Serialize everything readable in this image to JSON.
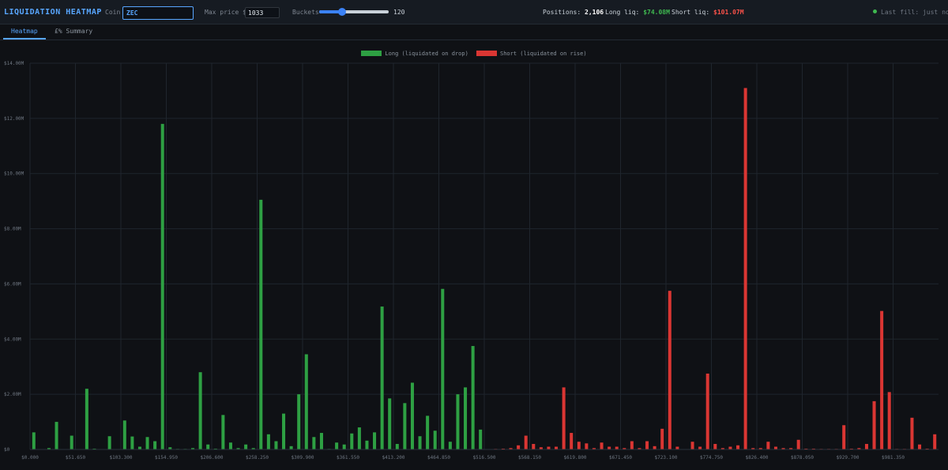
{
  "header": {
    "title": "LIQUIDATION HEATMAP",
    "coin_label": "Coin",
    "coin_value": "ZEC",
    "max_price_label": "Max price $",
    "max_price_value": "1033",
    "buckets_label": "Buckets",
    "buckets_value": "120",
    "buckets_fraction": 0.33,
    "positions_label": "Positions:",
    "positions_value": "2,106",
    "long_liq_label": "Long liq:",
    "long_liq_value": "$74.08M",
    "short_liq_label": "Short liq:",
    "short_liq_value": "$101.07M",
    "status_text": "Last fill: just now",
    "colors": {
      "accent": "#58a6ff",
      "long": "#2ea043",
      "short": "#da3633",
      "status_dot": "#3fb950"
    }
  },
  "tabs": [
    {
      "label": "Heatmap",
      "active": true
    },
    {
      "label": "£% Summary",
      "active": false
    }
  ],
  "chart_data": {
    "type": "bar",
    "legend": [
      {
        "label": "Long (liquidated on drop)",
        "color": "#2ea043"
      },
      {
        "label": "Short (liquidated on rise)",
        "color": "#da3633"
      }
    ],
    "legend_position": "top-center",
    "grid": true,
    "bucket_size": 8.6083,
    "xlim": [
      0,
      1033
    ],
    "ylim": [
      0,
      14000000
    ],
    "y_ticks": [
      0,
      2000000,
      4000000,
      6000000,
      8000000,
      10000000,
      12000000,
      14000000
    ],
    "y_tick_labels": [
      "$0",
      "$2.00M",
      "$4.00M",
      "$6.00M",
      "$8.00M",
      "$10.00M",
      "$12.00M",
      "$14.00M"
    ],
    "x_ticks": [
      0,
      51.65,
      103.3,
      154.95,
      206.6,
      258.25,
      309.9,
      361.55,
      413.2,
      464.85,
      516.5,
      568.15,
      619.8,
      671.45,
      723.1,
      774.75,
      826.4,
      878.05,
      929.7,
      981.35
    ],
    "x_tick_labels": [
      "$0.000",
      "$51.650",
      "$103.300",
      "$154.950",
      "$206.600",
      "$258.250",
      "$309.900",
      "$361.550",
      "$413.200",
      "$464.850",
      "$516.500",
      "$568.150",
      "$619.800",
      "$671.450",
      "$723.100",
      "$774.750",
      "$826.400",
      "$878.050",
      "$929.700",
      "$981.350"
    ],
    "series": [
      {
        "name": "Long (liquidated on drop)",
        "values": [
          0.62,
          0,
          0.05,
          1.0,
          0.01,
          0.5,
          0,
          2.2,
          0.03,
          0,
          0.48,
          0,
          1.05,
          0.47,
          0.1,
          0.45,
          0.3,
          11.8,
          0.08,
          0.02,
          0.02,
          0.05,
          2.8,
          0.18,
          0.03,
          1.25,
          0.25,
          0.05,
          0.18,
          0.05,
          9.05,
          0.55,
          0.3,
          1.3,
          0.12,
          2.0,
          3.45,
          0.45,
          0.6,
          0.02,
          0.25,
          0.18,
          0.58,
          0.8,
          0.32,
          0.62,
          5.18,
          1.85,
          0.2,
          1.68,
          2.42,
          0.48,
          1.22,
          0.68,
          5.82,
          0.28,
          2.0,
          2.25,
          3.75,
          0.72,
          0,
          0,
          0,
          0,
          0,
          0,
          0,
          0,
          0,
          0,
          0,
          0,
          0,
          0,
          0,
          0,
          0,
          0,
          0,
          0,
          0,
          0,
          0,
          0,
          0,
          0,
          0,
          0,
          0,
          0,
          0,
          0,
          0,
          0,
          0,
          0,
          0,
          0,
          0,
          0,
          0,
          0,
          0,
          0,
          0,
          0,
          0,
          0,
          0,
          0,
          0,
          0,
          0,
          0,
          0,
          0,
          0,
          0,
          0,
          0
        ]
      },
      {
        "name": "Short (liquidated on rise)",
        "values": [
          0,
          0,
          0,
          0,
          0,
          0,
          0,
          0,
          0,
          0,
          0,
          0,
          0,
          0,
          0,
          0,
          0,
          0,
          0,
          0,
          0,
          0,
          0,
          0,
          0,
          0,
          0,
          0,
          0,
          0,
          0,
          0,
          0,
          0,
          0,
          0,
          0,
          0,
          0,
          0,
          0,
          0,
          0,
          0,
          0,
          0,
          0,
          0,
          0,
          0,
          0,
          0,
          0,
          0,
          0,
          0,
          0,
          0,
          0,
          0,
          0.01,
          0.02,
          0.03,
          0.05,
          0.15,
          0.5,
          0.2,
          0.08,
          0.1,
          0.1,
          2.25,
          0.6,
          0.28,
          0.22,
          0.05,
          0.25,
          0.1,
          0.1,
          0.05,
          0.3,
          0.05,
          0.3,
          0.12,
          0.75,
          5.75,
          0.1,
          0.01,
          0.28,
          0.1,
          2.75,
          0.2,
          0.05,
          0.1,
          0.15,
          13.1,
          0.05,
          0.05,
          0.28,
          0.1,
          0.05,
          0.05,
          0.35,
          0.03,
          0.03,
          0.02,
          0.02,
          0.02,
          0.88,
          0.03,
          0.05,
          0.2,
          1.75,
          5.02,
          2.08,
          0.02,
          0.02,
          1.15,
          0.18,
          0.03,
          0.55
        ]
      }
    ],
    "value_unit": "$M"
  }
}
